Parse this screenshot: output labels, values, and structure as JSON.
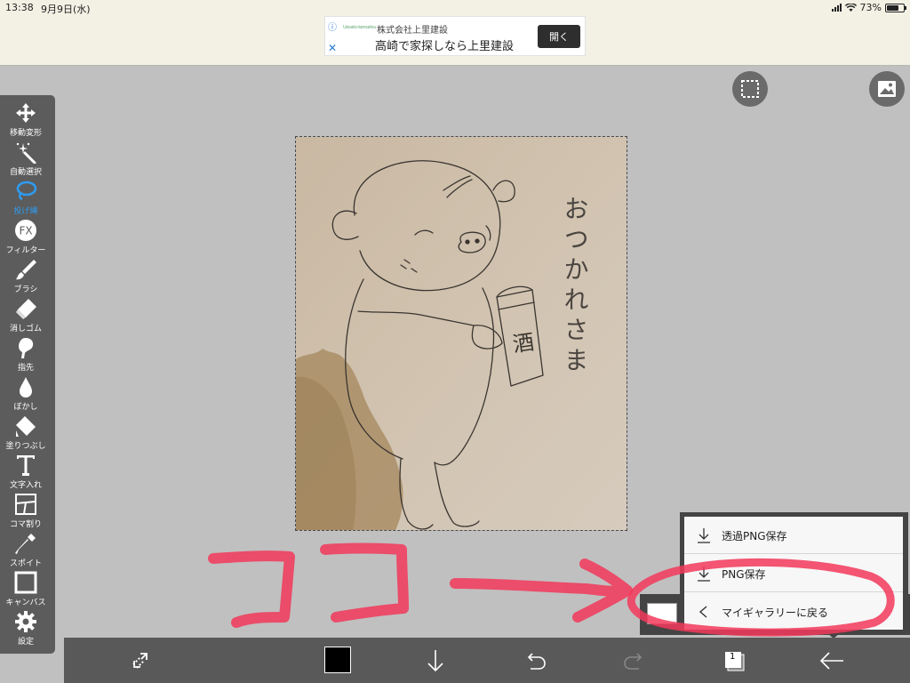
{
  "status_bar": {
    "time": "13:38",
    "date": "9月9日(水)",
    "battery": "73%"
  },
  "ad": {
    "info_icon": "info-icon",
    "close_icon": "close-icon",
    "logo_text": "Uesato-kensetsu",
    "company": "株式会社上里建設",
    "headline": "高崎で家探しなら上里建設",
    "button": "開く"
  },
  "toolbar": {
    "items": [
      {
        "label": "移動変形",
        "icon": "move-transform-icon"
      },
      {
        "label": "自動選択",
        "icon": "magic-wand-icon"
      },
      {
        "label": "投げ縄",
        "icon": "lasso-icon",
        "active": true
      },
      {
        "label": "フィルター",
        "icon": "fx-filter-icon"
      },
      {
        "label": "ブラシ",
        "icon": "brush-icon"
      },
      {
        "label": "消しゴム",
        "icon": "eraser-icon"
      },
      {
        "label": "指先",
        "icon": "finger-smudge-icon"
      },
      {
        "label": "ぼかし",
        "icon": "blur-drop-icon"
      },
      {
        "label": "塗りつぶし",
        "icon": "bucket-fill-icon"
      },
      {
        "label": "文字入れ",
        "icon": "text-icon"
      },
      {
        "label": "コマ割り",
        "icon": "panel-split-icon"
      },
      {
        "label": "スポイト",
        "icon": "eyedropper-icon"
      },
      {
        "label": "キャンバス",
        "icon": "canvas-icon"
      },
      {
        "label": "設定",
        "icon": "gear-icon"
      }
    ],
    "active_color": "#2f9bf0"
  },
  "canvas": {
    "drawing_text": "おつかれさま",
    "can_label": "酒"
  },
  "export_menu": {
    "items": [
      {
        "label": "透過PNG保存",
        "icon": "download-icon"
      },
      {
        "label": "PNG保存",
        "icon": "download-icon"
      },
      {
        "label": "マイギャラリーに戻る",
        "icon": "chevron-left-icon"
      }
    ]
  },
  "bottom_bar": {
    "layer_count": "1",
    "current_color": "#000000",
    "items": [
      "transform-swap-icon",
      "color-swatch",
      "download-icon",
      "undo-icon",
      "redo-icon",
      "layers-icon",
      "back-arrow-icon"
    ]
  },
  "annotation": {
    "text": "ココ",
    "color": "#f2385a"
  }
}
